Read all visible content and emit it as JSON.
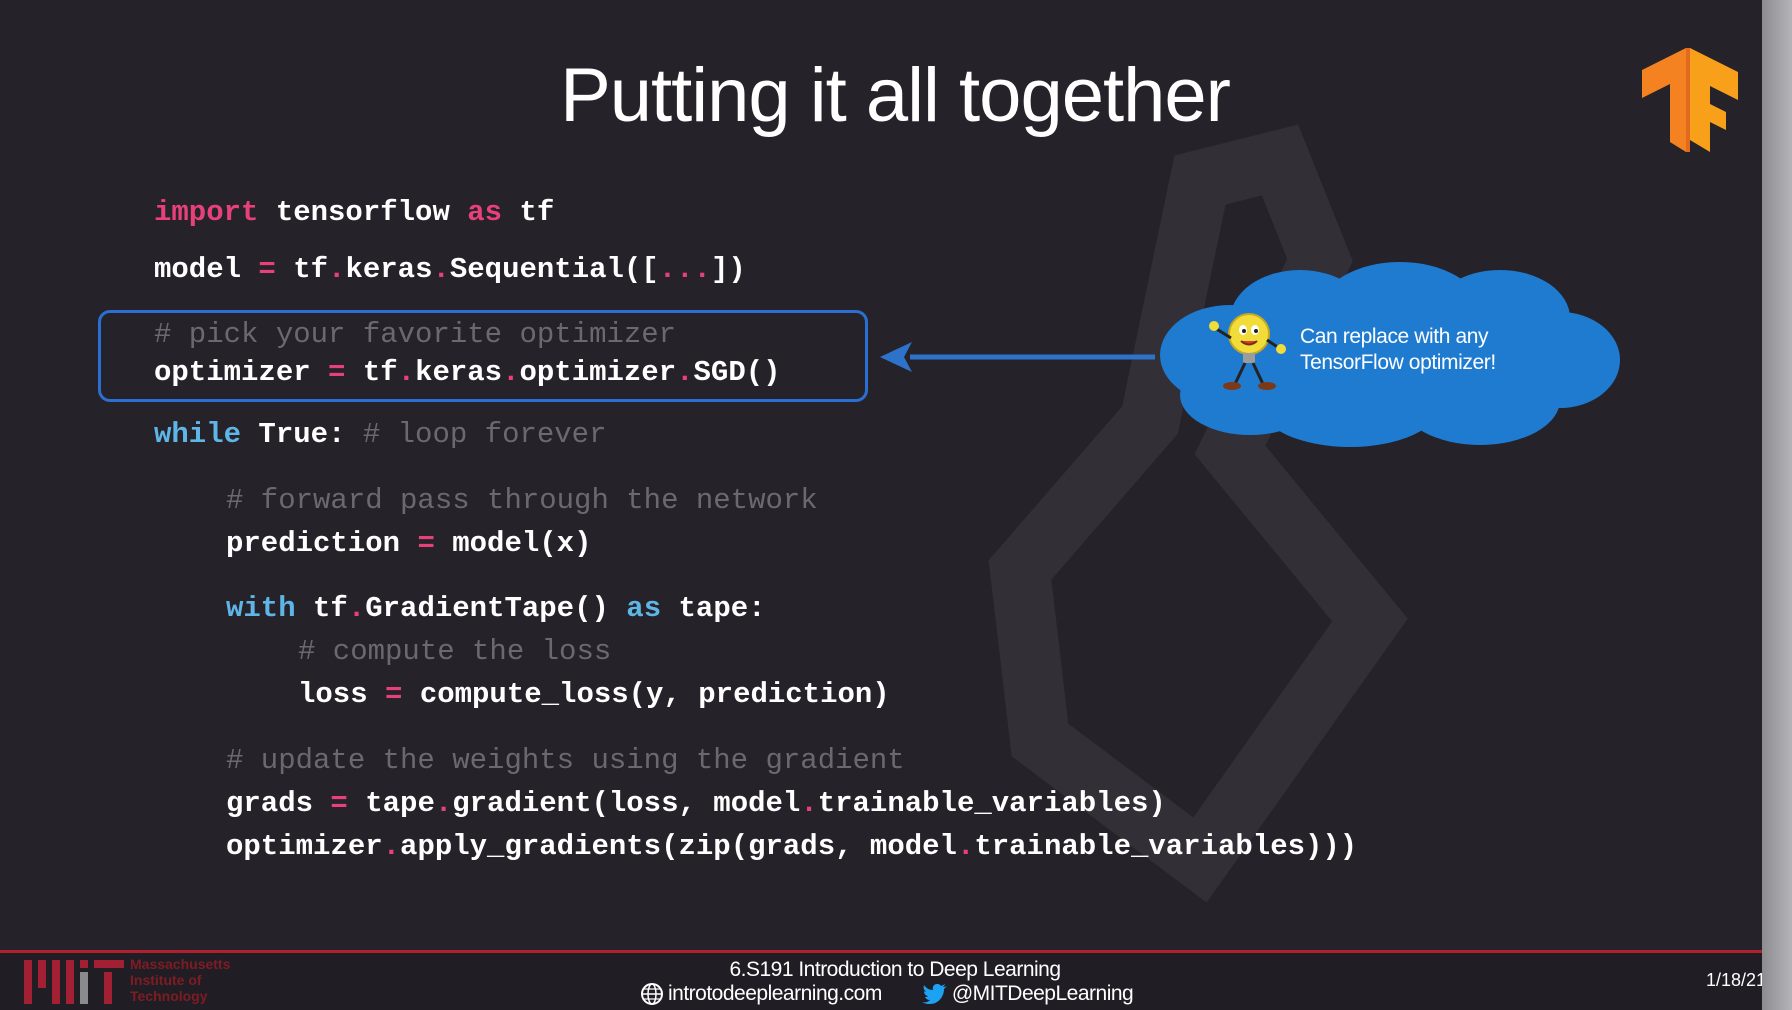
{
  "slide": {
    "title": "Putting it all together",
    "code_lines": {
      "l1": {
        "t1": "import",
        "t2": " tensorflow ",
        "t3": "as",
        "t4": " tf"
      },
      "l2": {
        "t1": "model ",
        "t2": "=",
        "t3": " tf",
        "t4": ".",
        "t5": "keras",
        "t6": ".",
        "t7": "Sequential([",
        "t8": "...",
        "t9": "])"
      },
      "l3": {
        "t1": "# pick your favorite optimizer"
      },
      "l4": {
        "t1": "optimizer ",
        "t2": "=",
        "t3": " tf",
        "t4": ".",
        "t5": "keras",
        "t6": ".",
        "t7": "optimizer",
        "t8": ".",
        "t9": "SGD()"
      },
      "l5": {
        "t1": "while",
        "t2": " True: ",
        "t3": "# loop forever"
      },
      "l6": {
        "t1": "# forward pass through the network"
      },
      "l7": {
        "t1": "prediction ",
        "t2": "=",
        "t3": " model(x)"
      },
      "l8": {
        "t1": "with",
        "t2": " tf",
        "t3": ".",
        "t4": "GradientTape() ",
        "t5": "as",
        "t6": " tape:"
      },
      "l9": {
        "t1": "# compute the loss"
      },
      "l10": {
        "t1": "loss ",
        "t2": "=",
        "t3": " compute_loss(y, prediction)"
      },
      "l11": {
        "t1": "# update the weights using the gradient"
      },
      "l12": {
        "t1": "grads ",
        "t2": "=",
        "t3": " tape",
        "t4": ".",
        "t5": "gradient(loss, model",
        "t6": ".",
        "t7": "trainable_variables)"
      },
      "l13": {
        "t1": "optimizer",
        "t2": ".",
        "t3": "apply_gradients(zip(grads, model",
        "t4": ".",
        "t5": "trainable_variables)))"
      }
    },
    "callout": {
      "line1": "Can replace with any",
      "line2": "TensorFlow optimizer!"
    }
  },
  "footer": {
    "mit_lines": [
      "Massachusetts",
      "Institute of",
      "Technology"
    ],
    "course": "6.S191 Introduction to Deep Learning",
    "website": "introtodeeplearning.com",
    "twitter": "@MITDeepLearning",
    "date": "1/18/21"
  },
  "colors": {
    "keyword_pink": "#e8417a",
    "keyword_blue": "#5fb6e6",
    "box_blue": "#2c6fd3",
    "cloud_blue": "#1f7bd0",
    "footer_red": "#b3202d"
  }
}
